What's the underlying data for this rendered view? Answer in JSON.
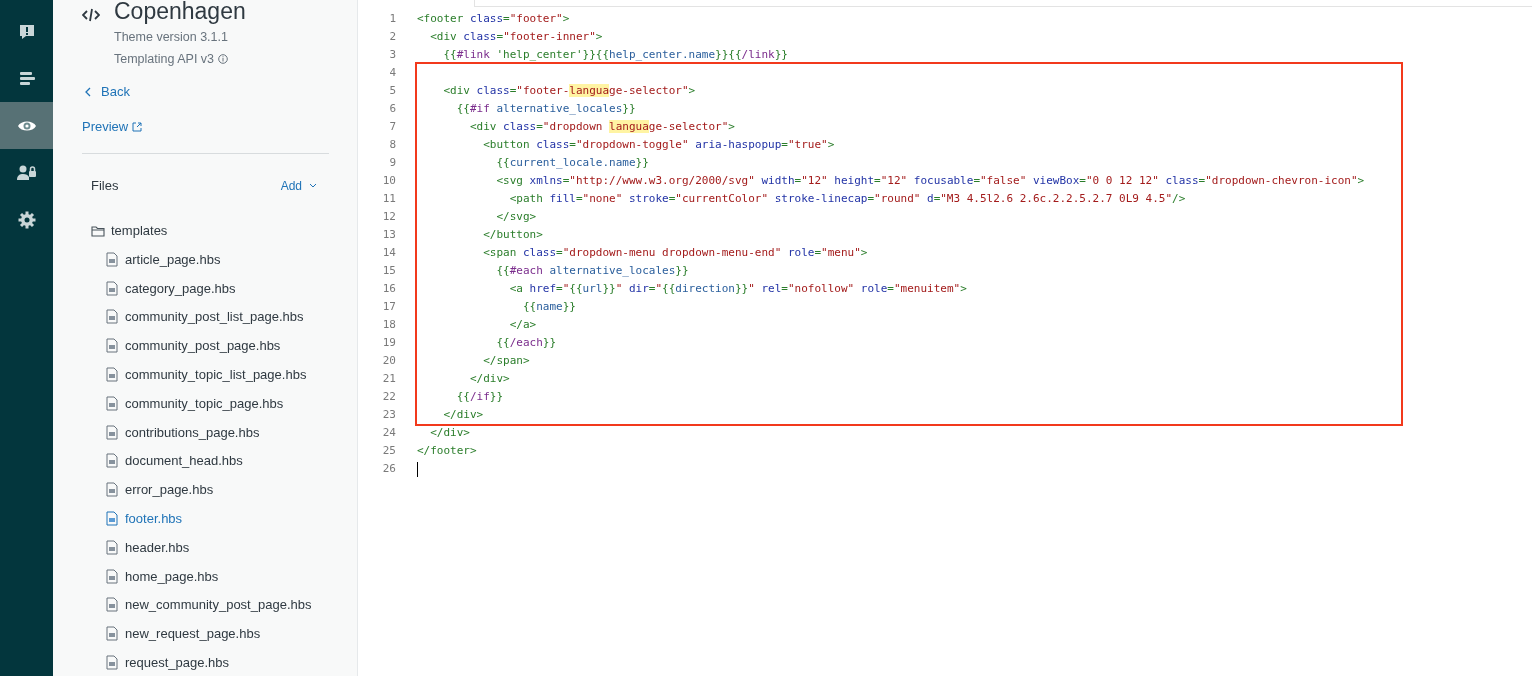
{
  "nav": {
    "items": [
      {
        "selected": false
      },
      {
        "selected": false
      },
      {
        "selected": true
      },
      {
        "selected": false
      },
      {
        "selected": false
      }
    ]
  },
  "theme": {
    "title": "Copenhagen",
    "version": "Theme version 3.1.1",
    "api": "Templating API v3"
  },
  "back": {
    "label": "Back"
  },
  "preview": {
    "label": "Preview"
  },
  "files": {
    "label": "Files",
    "add": "Add"
  },
  "tree": {
    "label": "templates",
    "children": [
      {
        "label": "article_page.hbs",
        "selected": false
      },
      {
        "label": "category_page.hbs",
        "selected": false
      },
      {
        "label": "community_post_list_page.hbs",
        "selected": false
      },
      {
        "label": "community_post_page.hbs",
        "selected": false
      },
      {
        "label": "community_topic_list_page.hbs",
        "selected": false
      },
      {
        "label": "community_topic_page.hbs",
        "selected": false
      },
      {
        "label": "contributions_page.hbs",
        "selected": false
      },
      {
        "label": "document_head.hbs",
        "selected": false
      },
      {
        "label": "error_page.hbs",
        "selected": false
      },
      {
        "label": "footer.hbs",
        "selected": true
      },
      {
        "label": "header.hbs",
        "selected": false
      },
      {
        "label": "home_page.hbs",
        "selected": false
      },
      {
        "label": "new_community_post_page.hbs",
        "selected": false
      },
      {
        "label": "new_request_page.hbs",
        "selected": false
      },
      {
        "label": "request_page.hbs",
        "selected": false
      }
    ]
  },
  "editor": {
    "annotation": {
      "color": "#f2391c"
    },
    "lines": [
      {
        "number": "1",
        "boxed": false,
        "cursor": false,
        "tokens": [
          {
            "kind": "tag",
            "text": "<footer"
          },
          {
            "kind": "attr",
            "text": " class"
          },
          {
            "kind": "tag",
            "text": "="
          },
          {
            "kind": "str",
            "text": "\"footer\""
          },
          {
            "kind": "tag",
            "text": ">"
          }
        ]
      },
      {
        "number": "2",
        "boxed": false,
        "cursor": false,
        "tokens": [
          {
            "kind": "tag",
            "text": "  <div"
          },
          {
            "kind": "attr",
            "text": " class"
          },
          {
            "kind": "tag",
            "text": "="
          },
          {
            "kind": "str",
            "text": "\"footer-inner\""
          },
          {
            "kind": "tag",
            "text": ">"
          }
        ]
      },
      {
        "number": "3",
        "boxed": false,
        "cursor": false,
        "tokens": [
          {
            "kind": "hbs",
            "text": "    {{"
          },
          {
            "kind": "helper",
            "text": "#link"
          },
          {
            "kind": "hbs",
            "text": " 'help_center'}}{{"
          },
          {
            "kind": "var",
            "text": "help_center.name"
          },
          {
            "kind": "hbs",
            "text": "}}{{"
          },
          {
            "kind": "helper",
            "text": "/link"
          },
          {
            "kind": "hbs",
            "text": "}}"
          }
        ]
      },
      {
        "number": "4",
        "boxed": true,
        "cursor": false
      },
      {
        "number": "5",
        "boxed": true,
        "cursor": false,
        "tokens": [
          {
            "kind": "tag",
            "text": "    <div"
          },
          {
            "kind": "attr",
            "text": " class"
          },
          {
            "kind": "tag",
            "text": "="
          },
          {
            "kind": "str",
            "text": "\"footer-"
          },
          {
            "kind": "match",
            "text": "langua"
          },
          {
            "kind": "str",
            "text": "ge-selector\""
          },
          {
            "kind": "tag",
            "text": ">"
          }
        ]
      },
      {
        "number": "6",
        "boxed": true,
        "cursor": false,
        "tokens": [
          {
            "kind": "hbs",
            "text": "      {{"
          },
          {
            "kind": "helper",
            "text": "#if"
          },
          {
            "kind": "var",
            "text": " alternative_locales"
          },
          {
            "kind": "hbs",
            "text": "}}"
          }
        ]
      },
      {
        "number": "7",
        "boxed": true,
        "cursor": false,
        "tokens": [
          {
            "kind": "tag",
            "text": "        <div"
          },
          {
            "kind": "attr",
            "text": " class"
          },
          {
            "kind": "tag",
            "text": "="
          },
          {
            "kind": "str",
            "text": "\"dropdown "
          },
          {
            "kind": "match",
            "text": "langua"
          },
          {
            "kind": "str",
            "text": "ge-selector\""
          },
          {
            "kind": "tag",
            "text": ">"
          }
        ]
      },
      {
        "number": "8",
        "boxed": true,
        "cursor": false,
        "tokens": [
          {
            "kind": "tag",
            "text": "          <button"
          },
          {
            "kind": "attr",
            "text": " class"
          },
          {
            "kind": "tag",
            "text": "="
          },
          {
            "kind": "str",
            "text": "\"dropdown-toggle\""
          },
          {
            "kind": "attr",
            "text": " aria-haspopup"
          },
          {
            "kind": "tag",
            "text": "="
          },
          {
            "kind": "str",
            "text": "\"true\""
          },
          {
            "kind": "tag",
            "text": ">"
          }
        ]
      },
      {
        "number": "9",
        "boxed": true,
        "cursor": false,
        "tokens": [
          {
            "kind": "hbs",
            "text": "            {{"
          },
          {
            "kind": "var",
            "text": "current_locale.name"
          },
          {
            "kind": "hbs",
            "text": "}}"
          }
        ]
      },
      {
        "number": "10",
        "boxed": true,
        "cursor": false,
        "tokens": [
          {
            "kind": "tag",
            "text": "            <svg"
          },
          {
            "kind": "attr",
            "text": " xmlns"
          },
          {
            "kind": "tag",
            "text": "="
          },
          {
            "kind": "str",
            "text": "\"http://www.w3.org/2000/svg\""
          },
          {
            "kind": "attr",
            "text": " width"
          },
          {
            "kind": "tag",
            "text": "="
          },
          {
            "kind": "str",
            "text": "\"12\""
          },
          {
            "kind": "attr",
            "text": " height"
          },
          {
            "kind": "tag",
            "text": "="
          },
          {
            "kind": "str",
            "text": "\"12\""
          },
          {
            "kind": "attr",
            "text": " focusable"
          },
          {
            "kind": "tag",
            "text": "="
          },
          {
            "kind": "str",
            "text": "\"false\""
          },
          {
            "kind": "attr",
            "text": " viewBox"
          },
          {
            "kind": "tag",
            "text": "="
          },
          {
            "kind": "str",
            "text": "\"0 0 12 12\""
          },
          {
            "kind": "attr",
            "text": " class"
          },
          {
            "kind": "tag",
            "text": "="
          },
          {
            "kind": "str",
            "text": "\"dropdown-chevron-icon\""
          },
          {
            "kind": "tag",
            "text": ">"
          }
        ]
      },
      {
        "number": "11",
        "boxed": true,
        "cursor": false,
        "tokens": [
          {
            "kind": "tag",
            "text": "              <path"
          },
          {
            "kind": "attr",
            "text": " fill"
          },
          {
            "kind": "tag",
            "text": "="
          },
          {
            "kind": "str",
            "text": "\"none\""
          },
          {
            "kind": "attr",
            "text": " stroke"
          },
          {
            "kind": "tag",
            "text": "="
          },
          {
            "kind": "str",
            "text": "\"currentColor\""
          },
          {
            "kind": "attr",
            "text": " stroke-linecap"
          },
          {
            "kind": "tag",
            "text": "="
          },
          {
            "kind": "str",
            "text": "\"round\""
          },
          {
            "kind": "attr",
            "text": " d"
          },
          {
            "kind": "tag",
            "text": "="
          },
          {
            "kind": "str",
            "text": "\"M3 4.5l2.6 2.6c.2.2.5.2.7 0L9 4.5\""
          },
          {
            "kind": "tag",
            "text": "/>"
          }
        ]
      },
      {
        "number": "12",
        "boxed": true,
        "cursor": false,
        "tokens": [
          {
            "kind": "tag",
            "text": "            </svg>"
          }
        ]
      },
      {
        "number": "13",
        "boxed": true,
        "cursor": false,
        "tokens": [
          {
            "kind": "tag",
            "text": "          </button>"
          }
        ]
      },
      {
        "number": "14",
        "boxed": true,
        "cursor": false,
        "tokens": [
          {
            "kind": "tag",
            "text": "          <span"
          },
          {
            "kind": "attr",
            "text": " class"
          },
          {
            "kind": "tag",
            "text": "="
          },
          {
            "kind": "str",
            "text": "\"dropdown-menu dropdown-menu-end\""
          },
          {
            "kind": "attr",
            "text": " role"
          },
          {
            "kind": "tag",
            "text": "="
          },
          {
            "kind": "str",
            "text": "\"menu\""
          },
          {
            "kind": "tag",
            "text": ">"
          }
        ]
      },
      {
        "number": "15",
        "boxed": true,
        "cursor": false,
        "tokens": [
          {
            "kind": "hbs",
            "text": "            {{"
          },
          {
            "kind": "helper",
            "text": "#each"
          },
          {
            "kind": "var",
            "text": " alternative_locales"
          },
          {
            "kind": "hbs",
            "text": "}}"
          }
        ]
      },
      {
        "number": "16",
        "boxed": true,
        "cursor": false,
        "tokens": [
          {
            "kind": "tag",
            "text": "              <a"
          },
          {
            "kind": "attr",
            "text": " href"
          },
          {
            "kind": "tag",
            "text": "="
          },
          {
            "kind": "str",
            "text": "\""
          },
          {
            "kind": "hbs",
            "text": "{{"
          },
          {
            "kind": "var",
            "text": "url"
          },
          {
            "kind": "hbs",
            "text": "}}"
          },
          {
            "kind": "str",
            "text": "\""
          },
          {
            "kind": "attr",
            "text": " dir"
          },
          {
            "kind": "tag",
            "text": "="
          },
          {
            "kind": "str",
            "text": "\""
          },
          {
            "kind": "hbs",
            "text": "{{"
          },
          {
            "kind": "var",
            "text": "direction"
          },
          {
            "kind": "hbs",
            "text": "}}"
          },
          {
            "kind": "str",
            "text": "\""
          },
          {
            "kind": "attr",
            "text": " rel"
          },
          {
            "kind": "tag",
            "text": "="
          },
          {
            "kind": "str",
            "text": "\"nofollow\""
          },
          {
            "kind": "attr",
            "text": " role"
          },
          {
            "kind": "tag",
            "text": "="
          },
          {
            "kind": "str",
            "text": "\"menuitem\""
          },
          {
            "kind": "tag",
            "text": ">"
          }
        ]
      },
      {
        "number": "17",
        "boxed": true,
        "cursor": false,
        "tokens": [
          {
            "kind": "hbs",
            "text": "                {{"
          },
          {
            "kind": "var",
            "text": "name"
          },
          {
            "kind": "hbs",
            "text": "}}"
          }
        ]
      },
      {
        "number": "18",
        "boxed": true,
        "cursor": false,
        "tokens": [
          {
            "kind": "tag",
            "text": "              </a>"
          }
        ]
      },
      {
        "number": "19",
        "boxed": true,
        "cursor": false,
        "tokens": [
          {
            "kind": "hbs",
            "text": "            {{"
          },
          {
            "kind": "helper",
            "text": "/each"
          },
          {
            "kind": "hbs",
            "text": "}}"
          }
        ]
      },
      {
        "number": "20",
        "boxed": true,
        "cursor": false,
        "tokens": [
          {
            "kind": "tag",
            "text": "          </span>"
          }
        ]
      },
      {
        "number": "21",
        "boxed": true,
        "cursor": false,
        "tokens": [
          {
            "kind": "tag",
            "text": "        </div>"
          }
        ]
      },
      {
        "number": "22",
        "boxed": true,
        "cursor": false,
        "tokens": [
          {
            "kind": "hbs",
            "text": "      {{"
          },
          {
            "kind": "helper",
            "text": "/if"
          },
          {
            "kind": "hbs",
            "text": "}}"
          }
        ]
      },
      {
        "number": "23",
        "boxed": true,
        "cursor": false,
        "tokens": [
          {
            "kind": "tag",
            "text": "    </div>"
          }
        ]
      },
      {
        "number": "24",
        "boxed": false,
        "cursor": false,
        "tokens": [
          {
            "kind": "tag",
            "text": "  </div>"
          }
        ]
      },
      {
        "number": "25",
        "boxed": false,
        "cursor": false,
        "tokens": [
          {
            "kind": "tag",
            "text": "</footer>"
          }
        ]
      },
      {
        "number": "26",
        "boxed": false,
        "cursor": true
      }
    ]
  }
}
